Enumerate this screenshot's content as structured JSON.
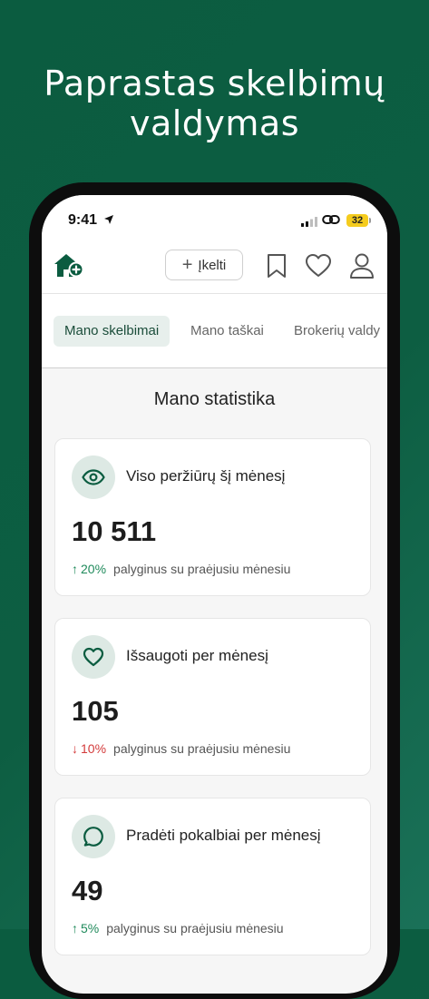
{
  "promo": {
    "title_line1": "Paprastas skelbimų",
    "title_line2": "valdymas"
  },
  "status_bar": {
    "time": "9:41",
    "battery": "32"
  },
  "header": {
    "upload_label": "Įkelti"
  },
  "tabs": [
    {
      "label": "Mano skelbimai",
      "active": true
    },
    {
      "label": "Mano taškai",
      "active": false
    },
    {
      "label": "Brokerių valdy",
      "active": false
    }
  ],
  "stats": {
    "title": "Mano statistika",
    "cards": [
      {
        "icon": "eye-icon",
        "label": "Viso peržiūrų šį mėnesį",
        "value": "10 511",
        "trend": "up",
        "change": "20%",
        "note": "palyginus su praėjusiu mėnesiu"
      },
      {
        "icon": "heart-icon",
        "label": "Išsaugoti per mėnesį",
        "value": "105",
        "trend": "down",
        "change": "10%",
        "note": "palyginus su praėjusiu mėnesiu"
      },
      {
        "icon": "chat-bubble-icon",
        "label": "Pradėti pokalbiai per mėnesį",
        "value": "49",
        "trend": "up",
        "change": "5%",
        "note": "palyginus su praėjusiu mėnesiu"
      }
    ]
  },
  "colors": {
    "brand_green": "#0b5c40",
    "accent_green": "#1f8a5b",
    "negative_red": "#d33a3a",
    "icon_bg": "#dde9e4"
  }
}
